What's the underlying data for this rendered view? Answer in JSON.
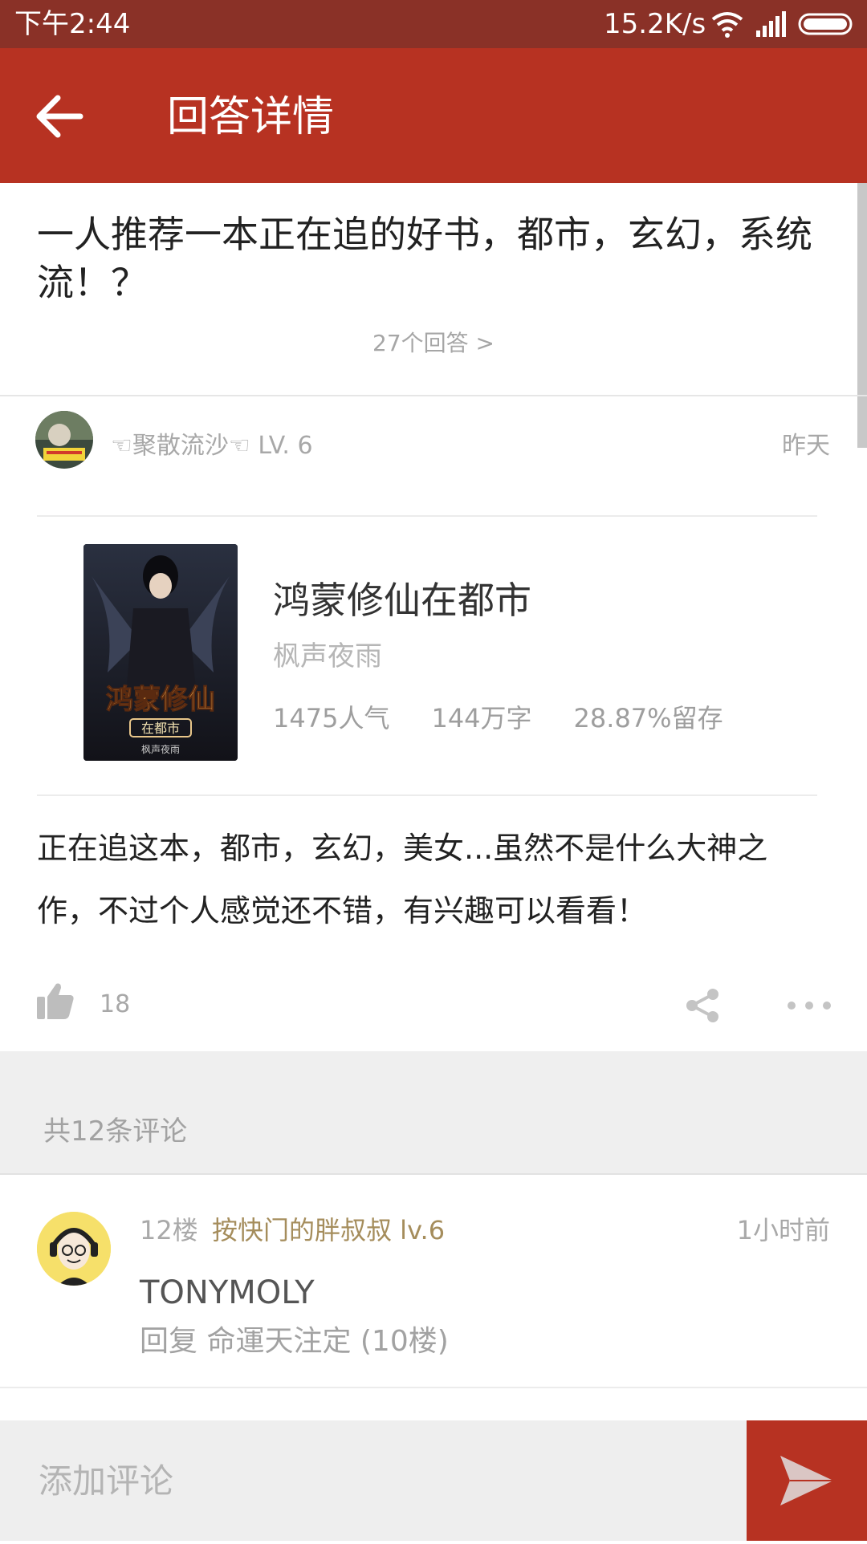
{
  "status_bar": {
    "time": "下午2:44",
    "speed": "15.2K/s"
  },
  "app_bar": {
    "title": "回答详情"
  },
  "question": {
    "title": "一人推荐一本正在追的好书，都市，玄幻，系统流！？",
    "answers_link": "27个回答 >"
  },
  "author": {
    "name": "☜聚散流沙☜ LV. 6",
    "time": "昨天"
  },
  "book": {
    "title": "鸿蒙修仙在都市",
    "author": "枫声夜雨",
    "cover_text": "鸿蒙修仙",
    "cover_subtitle": "在都市",
    "stats": {
      "popularity": "1475人气",
      "words": "144万字",
      "retention": "28.87%留存"
    }
  },
  "answer": {
    "text": "正在追这本，都市，玄幻，美女...虽然不是什么大神之作，不过个人感觉还不错，有兴趣可以看看！"
  },
  "actions": {
    "like_count": "18"
  },
  "comments": {
    "count_label": "共12条评论",
    "items": [
      {
        "floor": "12楼",
        "user": "按快门的胖叔叔 lv.6",
        "time": "1小时前",
        "text": "TONYMOLY",
        "reply_to": "回复 命運天注定 (10楼)"
      }
    ]
  },
  "input": {
    "placeholder": "添加评论"
  },
  "colors": {
    "status_bar": "#8a3127",
    "app_bar": "#b73222",
    "send_button": "#b73222",
    "username": "#a58d5c"
  }
}
